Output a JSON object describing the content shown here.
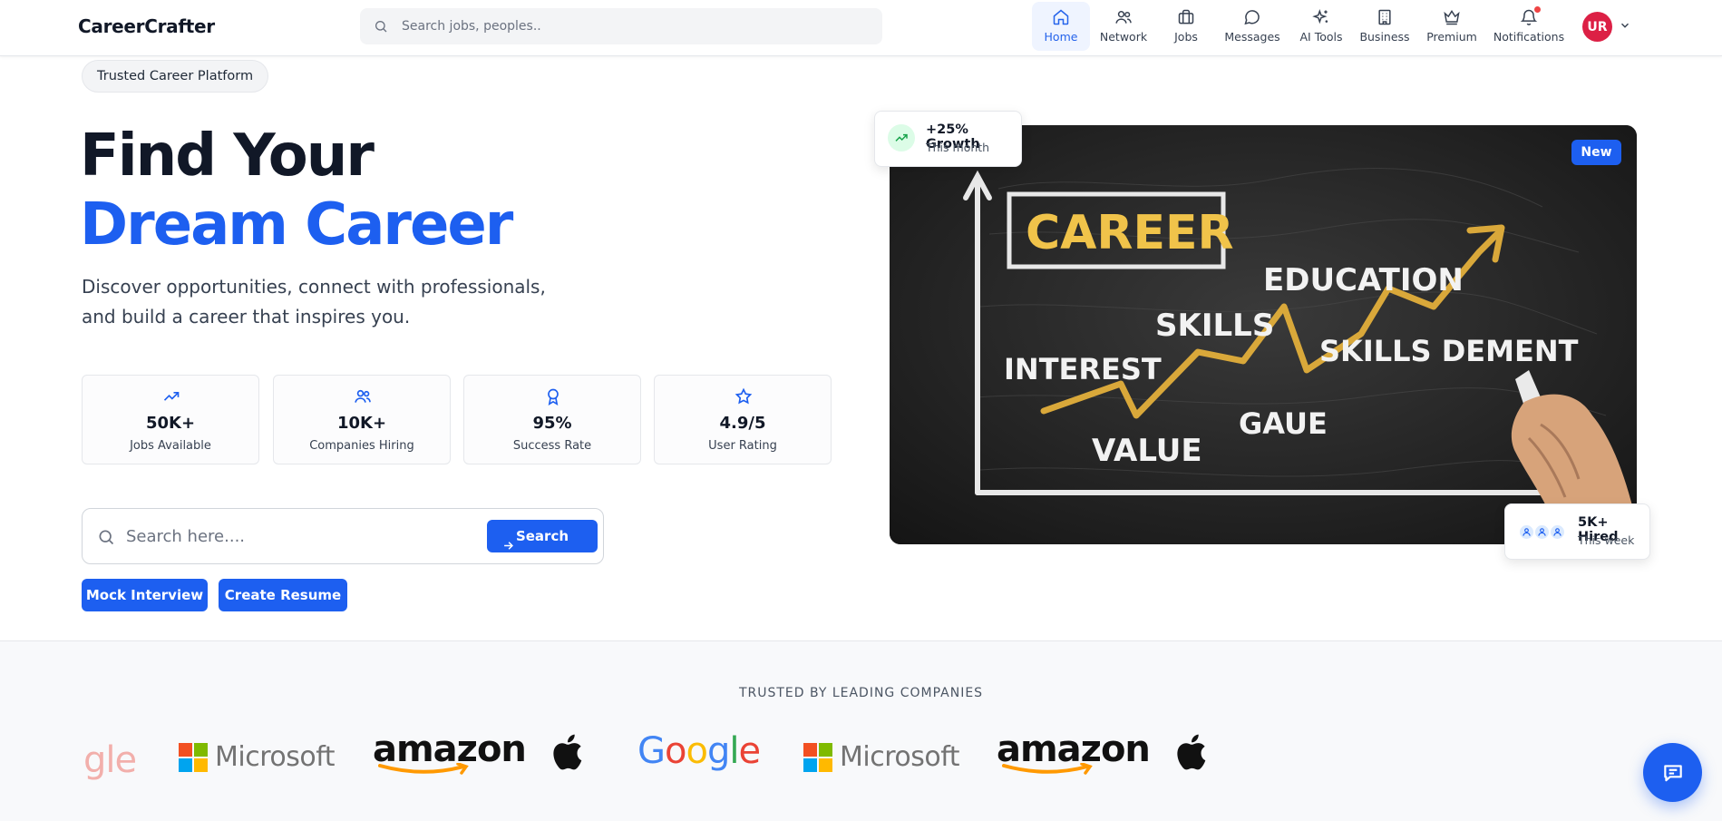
{
  "nav": {
    "brand": "CareerCrafter",
    "search_placeholder": "Search jobs, peoples..",
    "items": [
      {
        "label": "Home",
        "icon": "home-icon",
        "active": true
      },
      {
        "label": "Network",
        "icon": "network-icon"
      },
      {
        "label": "Jobs",
        "icon": "briefcase-icon"
      },
      {
        "label": "Messages",
        "icon": "message-icon"
      },
      {
        "label": "AI Tools",
        "icon": "sparkles-icon"
      },
      {
        "label": "Business",
        "icon": "building-icon"
      },
      {
        "label": "Premium",
        "icon": "crown-icon"
      },
      {
        "label": "Notifications",
        "icon": "bell-icon"
      }
    ],
    "avatar_initials": "UR"
  },
  "hero": {
    "badge": "Trusted Career Platform",
    "title_line1": "Find Your",
    "title_line2": "Dream Career",
    "lead_line1": "Discover opportunities, connect with professionals,",
    "lead_line2": "and build a career that inspires you.",
    "stats": [
      {
        "value": "50K+",
        "label": "Jobs Available",
        "icon": "trending-up-icon"
      },
      {
        "value": "10K+",
        "label": "Companies Hiring",
        "icon": "users-icon"
      },
      {
        "value": "95%",
        "label": "Success Rate",
        "icon": "award-icon"
      },
      {
        "value": "4.9/5",
        "label": "User Rating",
        "icon": "star-icon"
      }
    ],
    "search_placeholder": "Search here....",
    "search_button": "Search",
    "buttons": {
      "mock_interview": "Mock Interview",
      "create_resume": "Create Resume"
    },
    "image": {
      "new_badge": "New",
      "growth_title": "+25% Growth",
      "growth_sub": "This month",
      "hired_title": "5K+ Hired",
      "hired_sub": "This week",
      "chalk_words": {
        "career": "CAREER",
        "education": "EDUCATION",
        "skills": "SKILLS",
        "interest": "INTEREST",
        "skills_dement": "SKILLS DEMENT",
        "gaue": "GAUE",
        "value": "VALUE"
      }
    }
  },
  "trusted": {
    "title": "TRUSTED BY LEADING COMPANIES",
    "logos": {
      "google_partial": "gle",
      "microsoft": "Microsoft",
      "amazon": "amazon",
      "google": "Google"
    }
  },
  "colors": {
    "accent": "#1d5ff0",
    "avatar": "#dc2045",
    "notification": "#ef4444"
  }
}
